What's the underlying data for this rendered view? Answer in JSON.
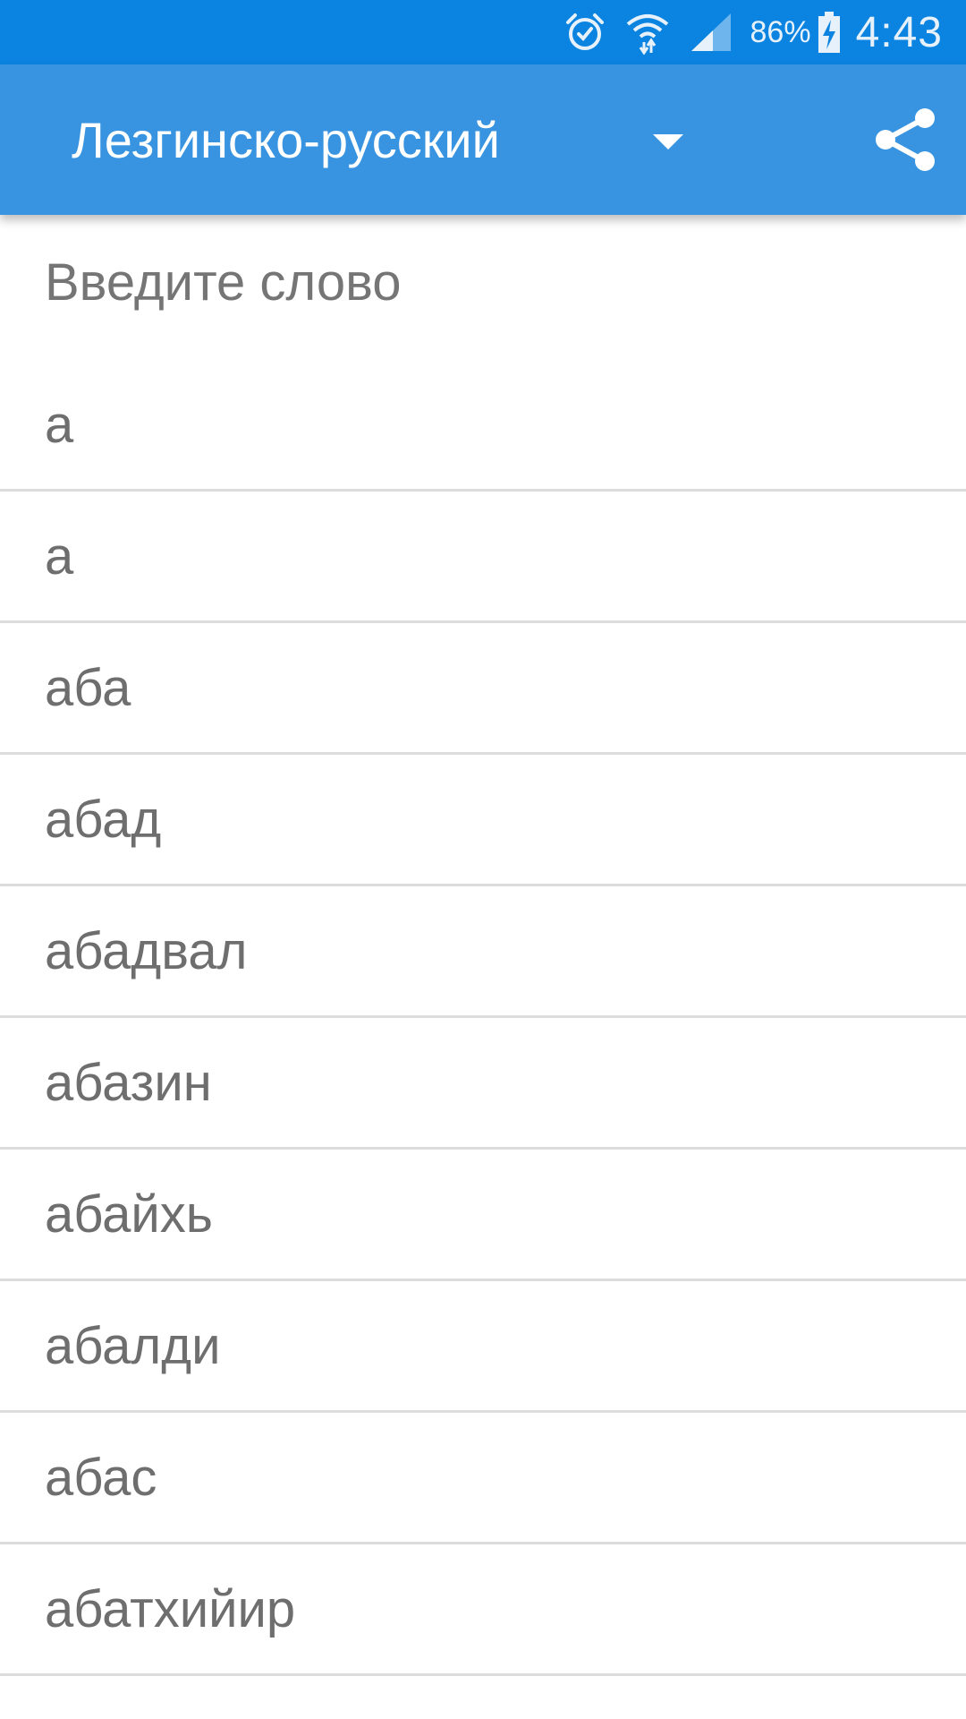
{
  "status_bar": {
    "icons": [
      "alarm-icon",
      "wifi-icon",
      "signal-icon",
      "battery-charging-icon"
    ],
    "battery_percent": "86%",
    "time": "4:43",
    "background_color": "#0a84e0"
  },
  "app_bar": {
    "language_label": "Лезгинско-русский",
    "dropdown_icon": "dropdown-arrow-icon",
    "share_icon": "share-icon",
    "background_color": "#3894e0"
  },
  "search": {
    "placeholder": "Введите слово",
    "value": ""
  },
  "word_list": [
    "а",
    "а",
    "аба",
    "абад",
    "абадвал",
    "абазин",
    "абайхь",
    "абалди",
    "абас",
    "абатхийир"
  ]
}
